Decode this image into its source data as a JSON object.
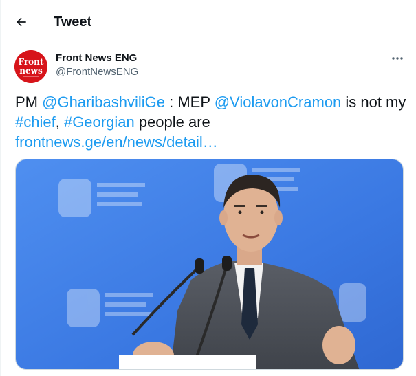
{
  "header": {
    "title": "Tweet"
  },
  "icons": {
    "back": "arrow-left-icon",
    "more": "more-horizontal-icon"
  },
  "author": {
    "name": "Front News ENG",
    "handle": "@FrontNewsENG",
    "avatar": {
      "line1": "Front",
      "line2": "news",
      "color": "#d7141a"
    }
  },
  "tweet": {
    "t1": "PM ",
    "mention1": "@GharibashviliGe",
    "t2": " : MEP ",
    "mention2": "@ViolavonCramon",
    "t3": " is not my ",
    "hashtag1": "#chief",
    "t4": ", ",
    "hashtag2": "#Georgian",
    "t5": " people are ",
    "link": "frontnews.ge/en/news/detail…"
  },
  "colors": {
    "accent": "#1d9bf0",
    "text": "#0f1419",
    "muted": "#536471",
    "backdrop": "#3f7fe6"
  }
}
